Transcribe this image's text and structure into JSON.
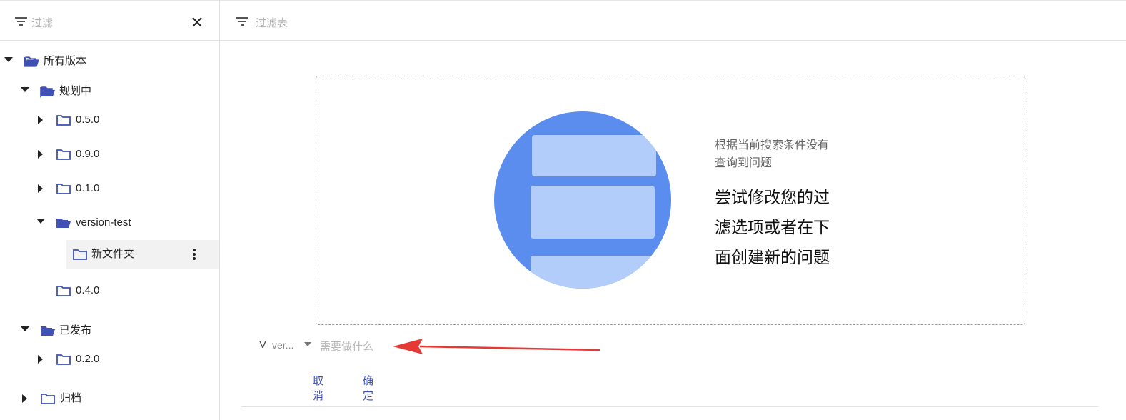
{
  "sidebar": {
    "filter_placeholder": "过滤",
    "tree": [
      {
        "label": "所有版本",
        "expanded": true,
        "open_folder": true
      },
      {
        "label": "规划中",
        "expanded": true,
        "open_folder": true
      },
      {
        "label": "0.5.0",
        "expanded": false,
        "open_folder": false
      },
      {
        "label": "0.9.0",
        "expanded": false,
        "open_folder": false
      },
      {
        "label": "0.1.0",
        "expanded": false,
        "open_folder": false
      },
      {
        "label": "version-test",
        "expanded": true,
        "open_folder": true
      },
      {
        "label": "新文件夹",
        "expanded": false,
        "open_folder": false,
        "selected": true
      },
      {
        "label": "0.4.0",
        "expanded": false,
        "open_folder": false
      },
      {
        "label": "已发布",
        "expanded": true,
        "open_folder": true
      },
      {
        "label": "0.2.0",
        "expanded": false,
        "open_folder": false
      },
      {
        "label": "归档",
        "expanded": false,
        "open_folder": false
      }
    ]
  },
  "main": {
    "filter_placeholder": "过滤表",
    "empty_state": {
      "subtitle_line1": "根据当前搜索条件没有",
      "subtitle_line2": "查询到问题",
      "message_line1": "尝试修改您的过",
      "message_line2": "滤选项或者在下",
      "message_line3": "面创建新的问题"
    },
    "create": {
      "version_prefix": "V",
      "version_name": "ver...",
      "input_placeholder": "需要做什么"
    },
    "actions": {
      "cancel_label": "取消",
      "confirm_label": "确定"
    }
  },
  "colors": {
    "accent": "#3f51b5",
    "folder": "#3f51b5",
    "annotation_arrow": "#e53935",
    "illustration_circle": "#5b8def",
    "illustration_card": "#b3cdfb"
  },
  "icons": {
    "filter": "filter-icon",
    "close": "close-icon",
    "folder": "folder-icon",
    "folder_open": "folder-open-icon",
    "more": "more-vertical-icon",
    "caret_down": "caret-down-icon",
    "caret_right": "caret-right-icon"
  }
}
